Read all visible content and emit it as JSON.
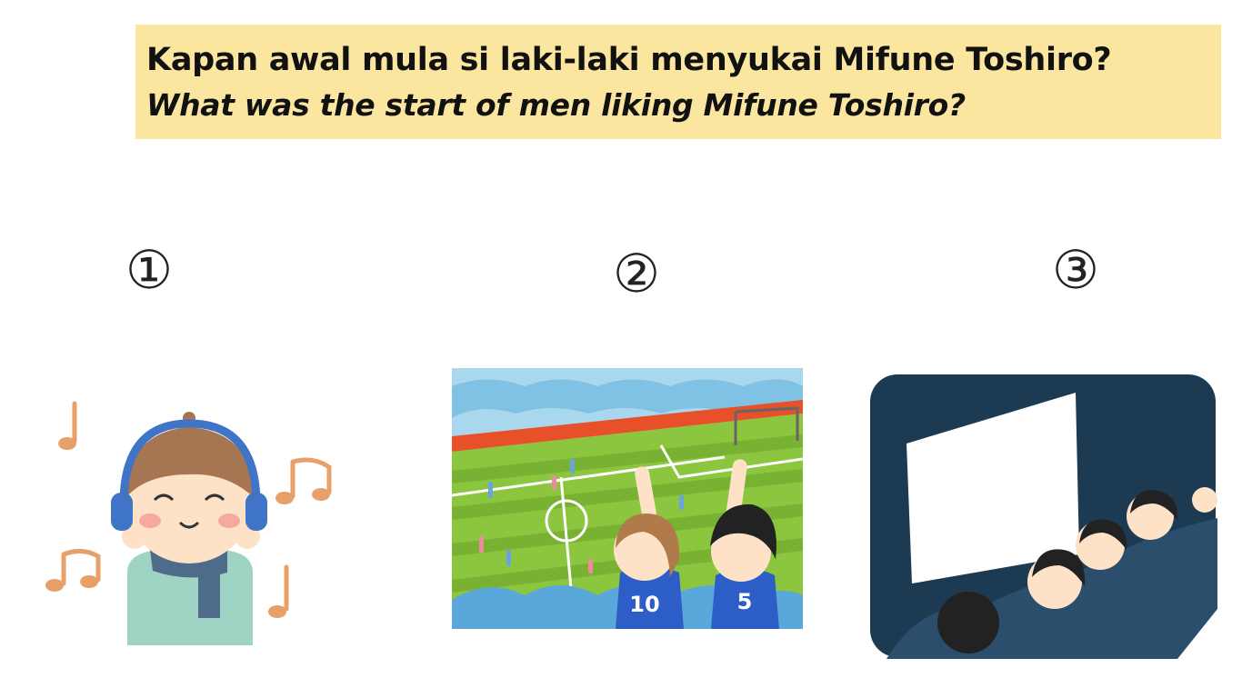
{
  "question": {
    "indonesian": "Kapan awal mula si laki-laki menyukai Mifune Toshiro?",
    "english": "What was the start of men liking Mifune Toshiro?"
  },
  "options": [
    {
      "number": "①",
      "illustration": "person-listening-to-music-icon"
    },
    {
      "number": "②",
      "illustration": "soccer-stadium-fans-icon"
    },
    {
      "number": "③",
      "illustration": "movie-theater-audience-icon"
    }
  ],
  "colors": {
    "banner": "#fbe6a0",
    "music_note": "#e8a06a",
    "field_green": "#8cc63f",
    "theater_dark": "#1c3a52"
  },
  "stadium_jerseys": [
    "10",
    "5"
  ]
}
